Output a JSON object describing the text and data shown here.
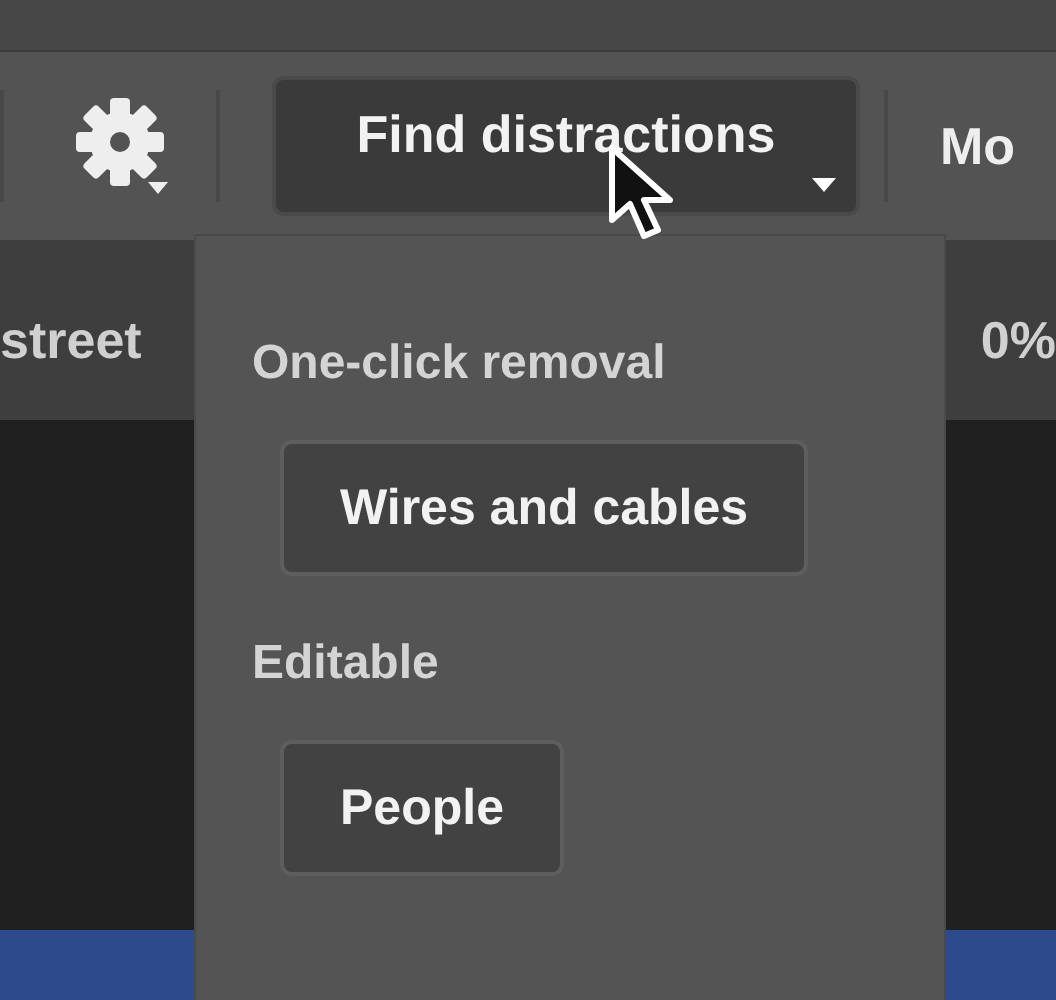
{
  "toolbar": {
    "dropdown_button": {
      "label": "Find distractions"
    },
    "cut_label": "Mo"
  },
  "document_bar": {
    "left_text": "street",
    "right_text": "0%"
  },
  "dropdown": {
    "sections": [
      {
        "heading": "One-click removal",
        "buttons": [
          "Wires and cables"
        ]
      },
      {
        "heading": "Editable",
        "buttons": [
          "People"
        ]
      }
    ]
  }
}
